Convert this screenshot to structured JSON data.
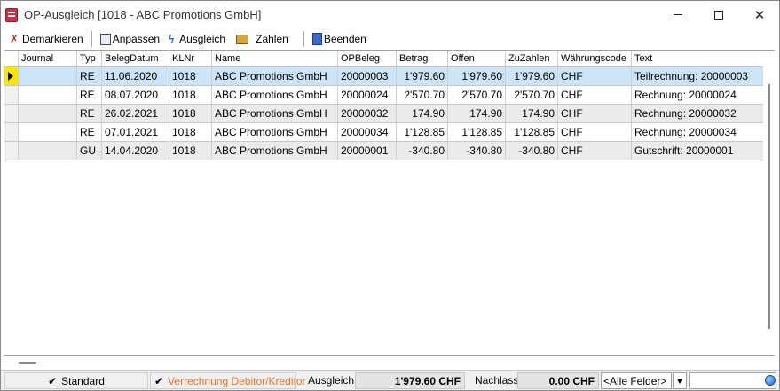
{
  "window": {
    "title": "OP-Ausgleich [1018 - ABC Promotions GmbH]",
    "minimize_icon": "minimize-icon",
    "maximize_icon": "maximize-icon",
    "close_glyph": "✕"
  },
  "toolbar": {
    "demarkieren": "Demarkieren",
    "anpassen": "Anpassen",
    "ausgleich": "Ausgleich",
    "zahlen": "Zahlen",
    "beenden": "Beenden"
  },
  "grid": {
    "columns": [
      "Journal",
      "Typ",
      "BelegDatum",
      "KLNr",
      "Name",
      "OPBeleg",
      "Betrag",
      "Offen",
      "ZuZahlen",
      "Währungscode",
      "Text"
    ],
    "rows": [
      {
        "journal": "",
        "typ": "RE",
        "datum": "11.06.2020",
        "klnr": "1018",
        "name": "ABC Promotions GmbH",
        "opbeleg": "20000003",
        "betrag": "1'979.60",
        "offen": "1'979.60",
        "zuzahlen": "1'979.60",
        "waehrung": "CHF",
        "text": "Teilrechnung: 20000003"
      },
      {
        "journal": "",
        "typ": "RE",
        "datum": "08.07.2020",
        "klnr": "1018",
        "name": "ABC Promotions GmbH",
        "opbeleg": "20000024",
        "betrag": "2'570.70",
        "offen": "2'570.70",
        "zuzahlen": "2'570.70",
        "waehrung": "CHF",
        "text": "Rechnung: 20000024"
      },
      {
        "journal": "",
        "typ": "RE",
        "datum": "26.02.2021",
        "klnr": "1018",
        "name": "ABC Promotions GmbH",
        "opbeleg": "20000032",
        "betrag": "174.90",
        "offen": "174.90",
        "zuzahlen": "174.90",
        "waehrung": "CHF",
        "text": "Rechnung: 20000032"
      },
      {
        "journal": "",
        "typ": "RE",
        "datum": "07.01.2021",
        "klnr": "1018",
        "name": "ABC Promotions GmbH",
        "opbeleg": "20000034",
        "betrag": "1'128.85",
        "offen": "1'128.85",
        "zuzahlen": "1'128.85",
        "waehrung": "CHF",
        "text": "Rechnung: 20000034"
      },
      {
        "journal": "",
        "typ": "GU",
        "datum": "14.04.2020",
        "klnr": "1018",
        "name": "ABC Promotions GmbH",
        "opbeleg": "20000001",
        "betrag": "-340.80",
        "offen": "-340.80",
        "zuzahlen": "-340.80",
        "waehrung": "CHF",
        "text": "Gutschrift: 20000001"
      }
    ]
  },
  "status": {
    "standard": "Standard",
    "verrechnung": "Verrechnung Debitor/Kreditor",
    "verrechnung_color": "#e8742a",
    "ausgleich_label": "Ausgleich",
    "ausgleich_value": "1'979.60 CHF",
    "nachlass_label": "Nachlass",
    "nachlass_value": "0.00 CHF",
    "filter_value": "<Alle Felder>",
    "check_glyph": "✔"
  }
}
